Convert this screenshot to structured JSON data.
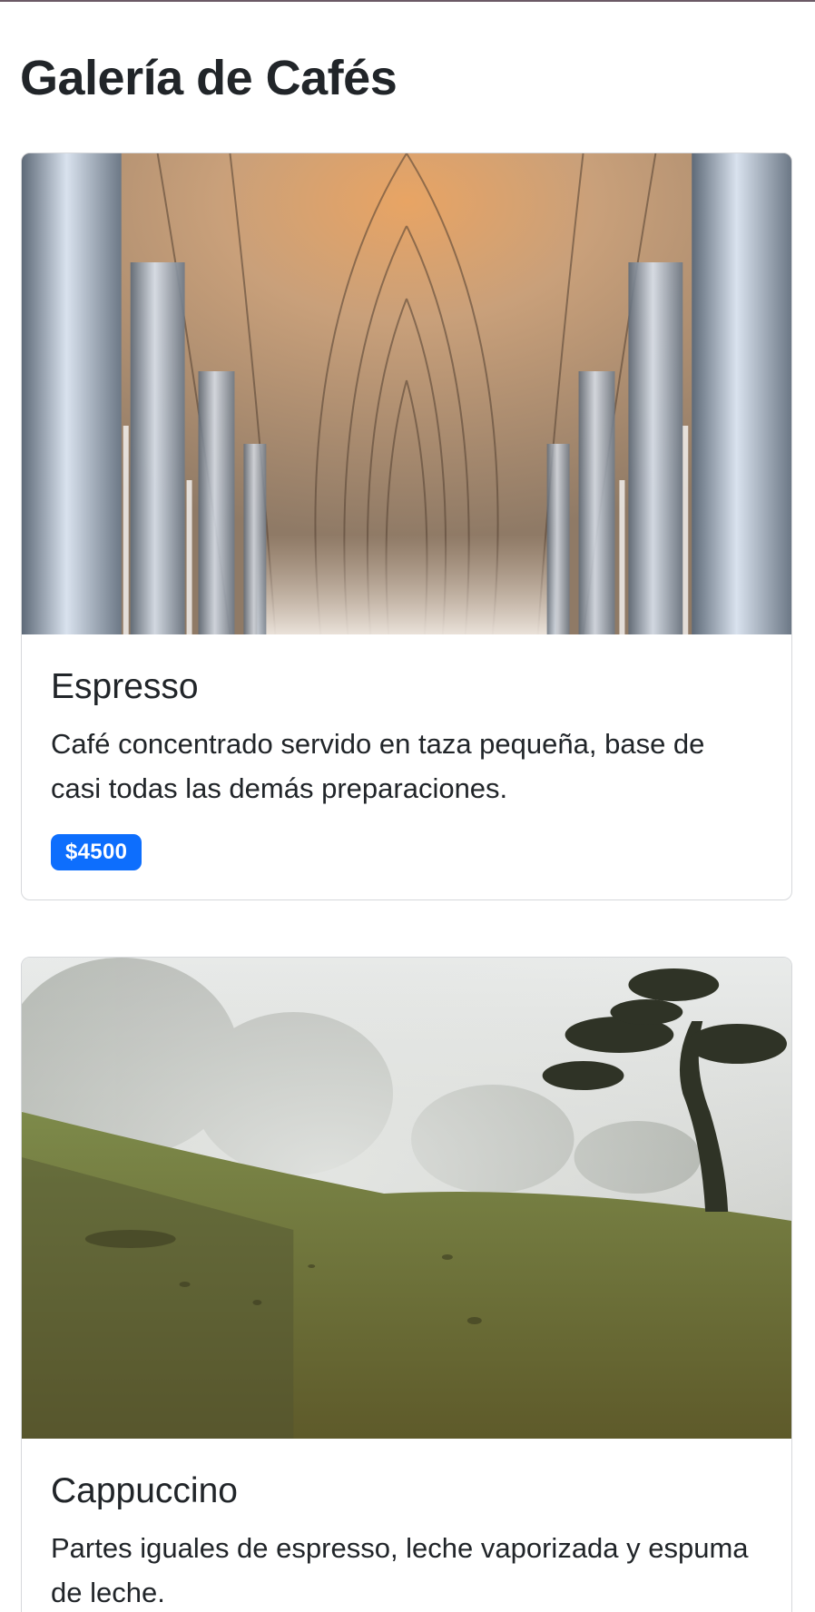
{
  "page": {
    "title": "Galería de Cafés"
  },
  "cards": [
    {
      "image_alt": "cathedral-vault-photo",
      "title": "Espresso",
      "description": "Café concentrado servido en taza pequeña, base de casi todas las demás preparaciones.",
      "price": "$4500"
    },
    {
      "image_alt": "foggy-tree-hillside-photo",
      "title": "Cappuccino",
      "description": "Partes iguales de espresso, leche vaporizada y espuma de leche."
    }
  ],
  "colors": {
    "badge": "#0d6efd",
    "text": "#212529",
    "border": "#d6d8db"
  }
}
